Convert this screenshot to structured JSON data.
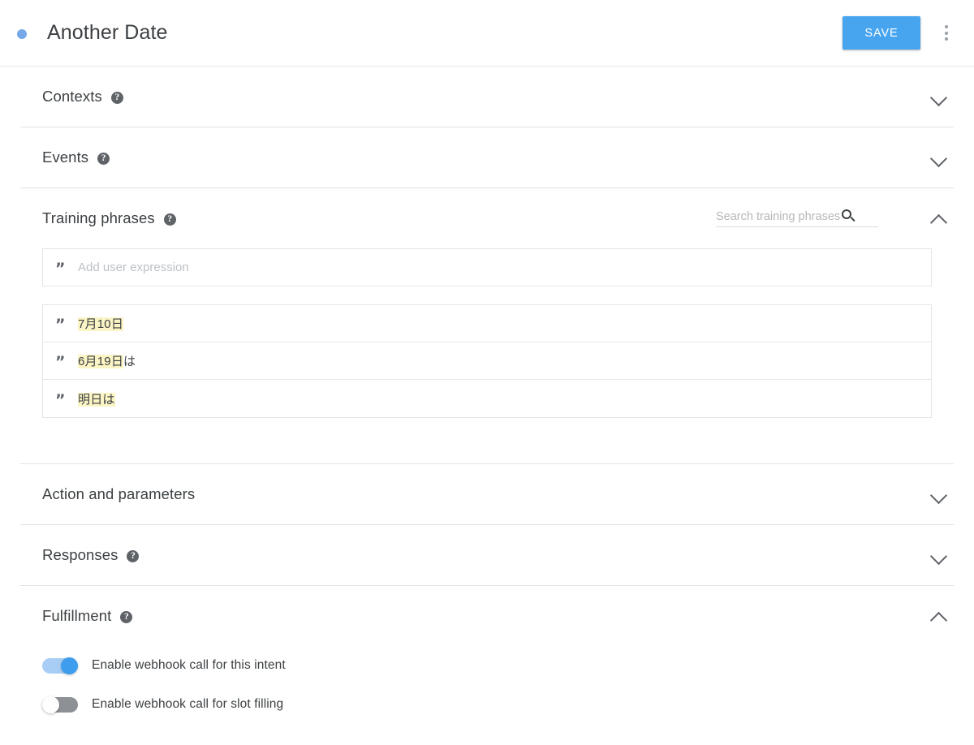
{
  "header": {
    "intent_title": "Another Date",
    "dot_color": "#76a9e8",
    "save_label": "SAVE",
    "menu_icon": "more-vert-icon"
  },
  "sections": {
    "contexts": {
      "title": "Contexts",
      "help": "?",
      "chevron": "chevron-down-icon"
    },
    "events": {
      "title": "Events",
      "help": "?",
      "chevron": "chevron-down-icon"
    },
    "training_phrases": {
      "title": "Training phrases",
      "help": "?",
      "chevron": "chevron-up-icon",
      "search_placeholder": "Search training phrases",
      "add_placeholder": "Add user expression",
      "quote_glyph": "”",
      "phrases": [
        {
          "parts": [
            {
              "text": "7月10日",
              "highlight": true
            }
          ]
        },
        {
          "parts": [
            {
              "text": "6月19日",
              "highlight": true
            },
            {
              "text": "は",
              "highlight": false
            }
          ]
        },
        {
          "parts": [
            {
              "text": "明日は",
              "highlight": true
            }
          ]
        }
      ],
      "highlight_color": "#fbf4c4"
    },
    "action_and_parameters": {
      "title": "Action and parameters",
      "chevron": "chevron-down-icon"
    },
    "responses": {
      "title": "Responses",
      "help": "?",
      "chevron": "chevron-down-icon"
    },
    "fulfillment": {
      "title": "Fulfillment",
      "help": "?",
      "chevron": "chevron-up-icon",
      "toggles": [
        {
          "label": "Enable webhook call for this intent",
          "on": true
        },
        {
          "label": "Enable webhook call for slot filling",
          "on": false
        }
      ]
    }
  },
  "colors": {
    "accent": "#47a4ef",
    "text": "#3c4043",
    "divider": "#e4e1e3"
  }
}
